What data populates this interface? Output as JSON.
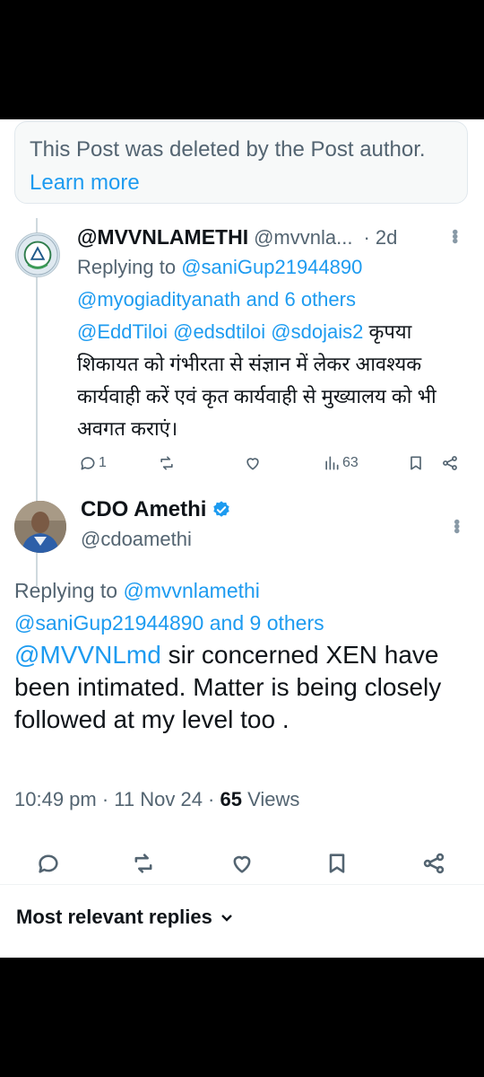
{
  "deleted_notice": {
    "text": "This Post was deleted by the Post author.",
    "link": "Learn more"
  },
  "reply": {
    "name": "@MVVNLAMETHI",
    "handle": "@mvvnla...",
    "time": "· 2d",
    "replying_prefix": "Replying to",
    "replying_mention1": "@saniGup21944890",
    "replying_mention2": "@myogiadityanath",
    "replying_suffix": "and 6 others",
    "mentions": "@EddTiloi @edsdtiloi @sdojais2",
    "text": "कृपया शिकायत को गंभीरता से संज्ञान में लेकर आवश्यक कार्यवाही करें एवं कृत कार्यवाही से मुख्यालय को भी अवगत कराएं।",
    "reply_count": "1",
    "views": "63"
  },
  "post": {
    "author_name": "CDO Amethi",
    "author_handle": "@cdoamethi",
    "replying_prefix": "Replying to",
    "replying_mention1": "@mvvnlamethi",
    "replying_mention2": "@saniGup21944890",
    "replying_suffix": "and 9 others",
    "mention": "@MVVNLmd",
    "text": " sir concerned XEN have been intimated.  Matter is being closely followed at my level too .",
    "timestamp": "10:49 pm · 11 Nov 24 · ",
    "views_count": "65",
    "views_label": " Views"
  },
  "sort_label": "Most relevant replies",
  "colors": {
    "link": "#1d9bf0",
    "muted": "#536471",
    "verified": "#1d9bf0"
  }
}
